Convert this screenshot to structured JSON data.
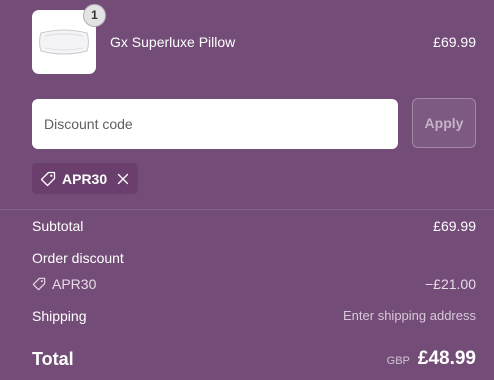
{
  "product": {
    "name": "Gx Superluxe Pillow",
    "price": "£69.99",
    "quantity": "1",
    "image_icon": "pillow-image"
  },
  "discount": {
    "placeholder": "Discount code",
    "value": "",
    "apply_label": "Apply",
    "applied_code": "APR30"
  },
  "summary": {
    "subtotal_label": "Subtotal",
    "subtotal_value": "£69.99",
    "order_discount_label": "Order discount",
    "discount_code": "APR30",
    "discount_amount": "−£21.00",
    "shipping_label": "Shipping",
    "shipping_value": "Enter shipping address",
    "total_label": "Total",
    "currency": "GBP",
    "total_value": "£48.99"
  },
  "colors": {
    "background": "#734d77",
    "tag_background": "#6a3f6d",
    "input_background": "#ffffff"
  }
}
